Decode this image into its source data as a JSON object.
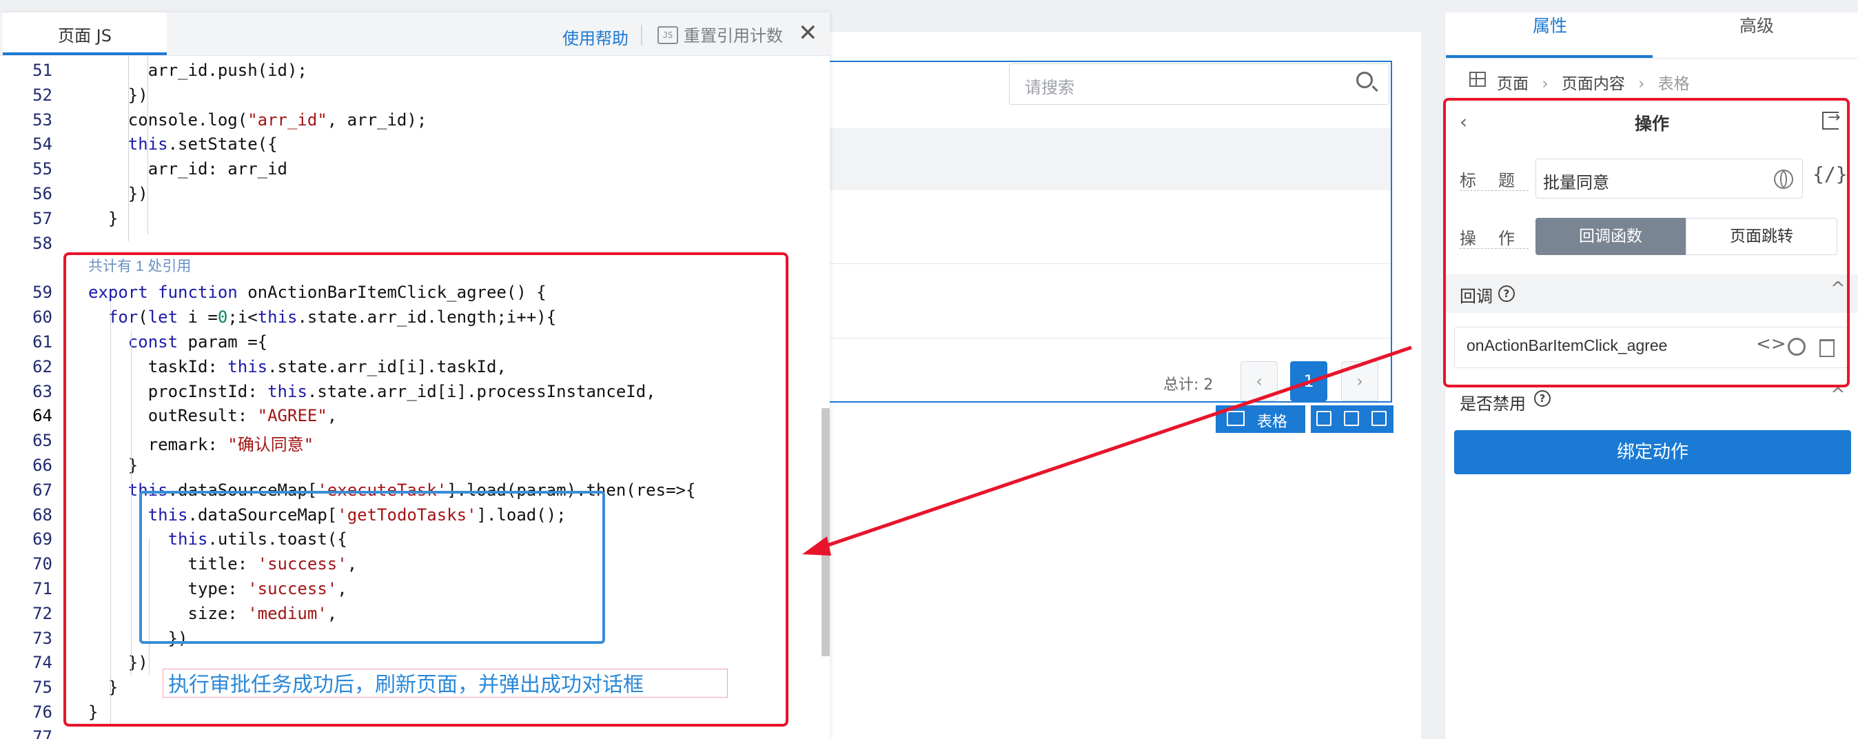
{
  "editor": {
    "tab_title": "页面 JS",
    "help_link": "使用帮助",
    "js_icon_text": "JS",
    "reset_button": "重置引用计数",
    "close_symbol": "✕",
    "reference_hint": "共计有 1 处引用",
    "current_line": 64,
    "lines": [
      {
        "n": 51,
        "code": "      arr_id.push(id);"
      },
      {
        "n": 52,
        "code": "    })"
      },
      {
        "n": 53,
        "code": "    console.log(\"arr_id\", arr_id);"
      },
      {
        "n": 54,
        "code": "    this.setState({"
      },
      {
        "n": 55,
        "code": "      arr_id: arr_id"
      },
      {
        "n": 56,
        "code": "    })"
      },
      {
        "n": 57,
        "code": "  }"
      },
      {
        "n": 58,
        "code": ""
      },
      {
        "n": 59,
        "code": "export function onActionBarItemClick_agree() {"
      },
      {
        "n": 60,
        "code": "  for(let i =0;i<this.state.arr_id.length;i++){"
      },
      {
        "n": 61,
        "code": "    const param ={"
      },
      {
        "n": 62,
        "code": "      taskId: this.state.arr_id[i].taskId,"
      },
      {
        "n": 63,
        "code": "      procInstId: this.state.arr_id[i].processInstanceId,"
      },
      {
        "n": 64,
        "code": "      outResult: \"AGREE\","
      },
      {
        "n": 65,
        "code": "      remark: \"确认同意\""
      },
      {
        "n": 66,
        "code": "    }"
      },
      {
        "n": 67,
        "code": "    this.dataSourceMap['executeTask'].load(param).then(res=>{"
      },
      {
        "n": 68,
        "code": "      this.dataSourceMap['getTodoTasks'].load();"
      },
      {
        "n": 69,
        "code": "        this.utils.toast({"
      },
      {
        "n": 70,
        "code": "          title: 'success',"
      },
      {
        "n": 71,
        "code": "          type: 'success',"
      },
      {
        "n": 72,
        "code": "          size: 'medium',"
      },
      {
        "n": 73,
        "code": "        })"
      },
      {
        "n": 74,
        "code": "    })"
      },
      {
        "n": 75,
        "code": "  }"
      },
      {
        "n": 76,
        "code": "}"
      },
      {
        "n": 77,
        "code": ""
      }
    ]
  },
  "canvas": {
    "search_placeholder": "请搜索",
    "total_label": "总计: 2",
    "pager_prev": "‹",
    "pager_page": "1",
    "pager_next": "›",
    "selection_tag": "表格"
  },
  "panel": {
    "tabs": [
      "属性",
      "高级"
    ],
    "breadcrumb": [
      "页面",
      "页面内容",
      "表格"
    ],
    "section_title": "操作",
    "back_symbol": "‹",
    "title_label": "标题",
    "title_value": "批量同意",
    "expr_symbol": "{/}",
    "op_label": "操作",
    "op_options": [
      "回调函数",
      "页面跳转"
    ],
    "op_selected": "回调函数",
    "callback_label": "回调",
    "callback_fn": "onActionBarItemClick_agree",
    "code_symbol": "<>",
    "disabled_label": "是否禁用",
    "bind_button": "绑定动作",
    "q_symbol": "?",
    "chevron_up": "^"
  },
  "annotation": {
    "note": "执行审批任务成功后，刷新页面，并弹出成功对话框",
    "color_red": "#e8142b",
    "color_blue": "#3a8ed6"
  }
}
